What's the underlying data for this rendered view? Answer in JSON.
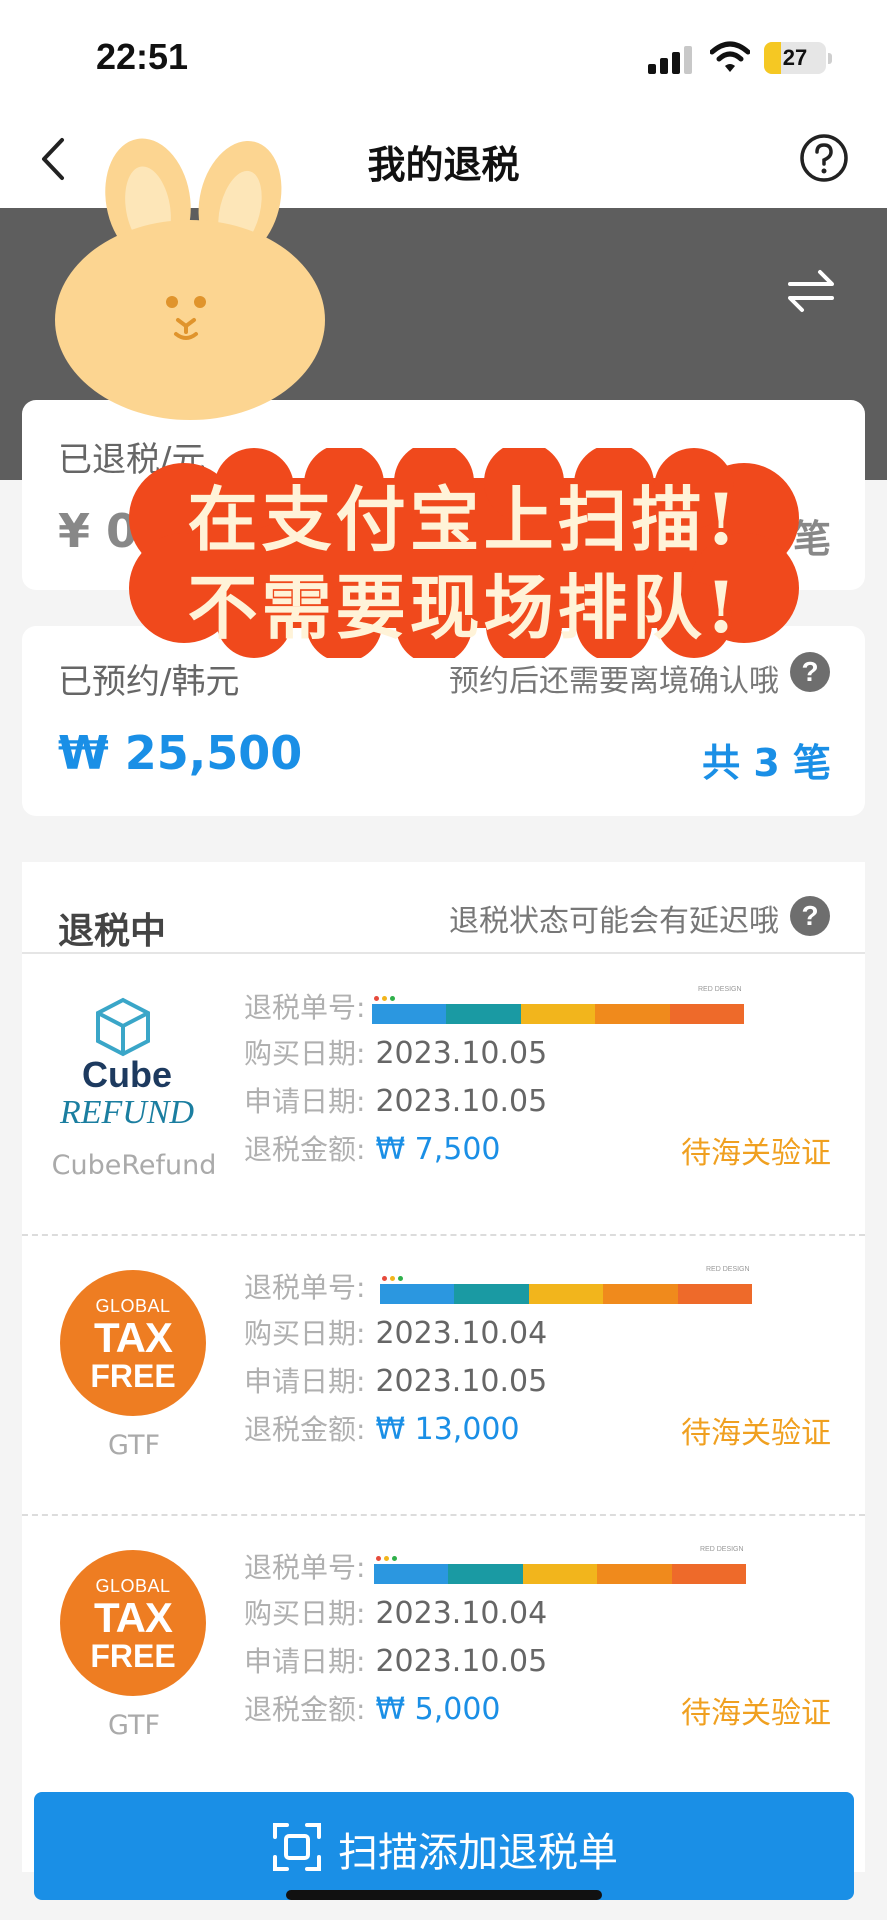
{
  "status_bar": {
    "time": "22:51",
    "battery": "27",
    "battery_level": 0.27
  },
  "nav": {
    "title": "我的退税"
  },
  "header": {
    "user_id_fragment": "7"
  },
  "refunded_card": {
    "label": "已退税/元",
    "amount": "¥ 0",
    "count_suffix": "笔"
  },
  "reserved_card": {
    "label": "已预约/韩元",
    "note": "预约后还需要离境确认哦",
    "amount": "₩ 25,500",
    "count": "共 3 笔"
  },
  "in_progress": {
    "title": "退税中",
    "note": "退税状态可能会有延迟哦",
    "labels": {
      "order_no": "退税单号:",
      "purchase_date": "购买日期:",
      "apply_date": "申请日期:",
      "amount": "退税金额:"
    },
    "items": [
      {
        "logo_name": "CubeRefund",
        "logo_line1": "Cube",
        "logo_line2": "REFUND",
        "purchase_date": "2023.10.05",
        "apply_date": "2023.10.05",
        "amount": "₩ 7,500",
        "status": "待海关验证",
        "redact_tag": "RED DESIGN"
      },
      {
        "logo_name": "GTF",
        "logo_line1": "GLOBAL",
        "logo_line2": "TAX",
        "logo_line3": "FREE",
        "purchase_date": "2023.10.04",
        "apply_date": "2023.10.05",
        "amount": "₩ 13,000",
        "status": "待海关验证",
        "redact_tag": "RED DESIGN"
      },
      {
        "logo_name": "GTF",
        "logo_line1": "GLOBAL",
        "logo_line2": "TAX",
        "logo_line3": "FREE",
        "purchase_date": "2023.10.04",
        "apply_date": "2023.10.05",
        "amount": "₩ 5,000",
        "status": "待海关验证",
        "redact_tag": "RED DESIGN"
      }
    ]
  },
  "bottom_button": {
    "label": "扫描添加退税单"
  },
  "sticker": {
    "line1": "在支付宝上扫描!",
    "line2": "不需要现场排队!"
  },
  "colors": {
    "accent_blue": "#1a8fe6",
    "status_orange": "#f0a020",
    "header_gray": "#5e5e5e",
    "gtf_orange": "#ee7d22",
    "sticker_red": "#f0491c"
  }
}
